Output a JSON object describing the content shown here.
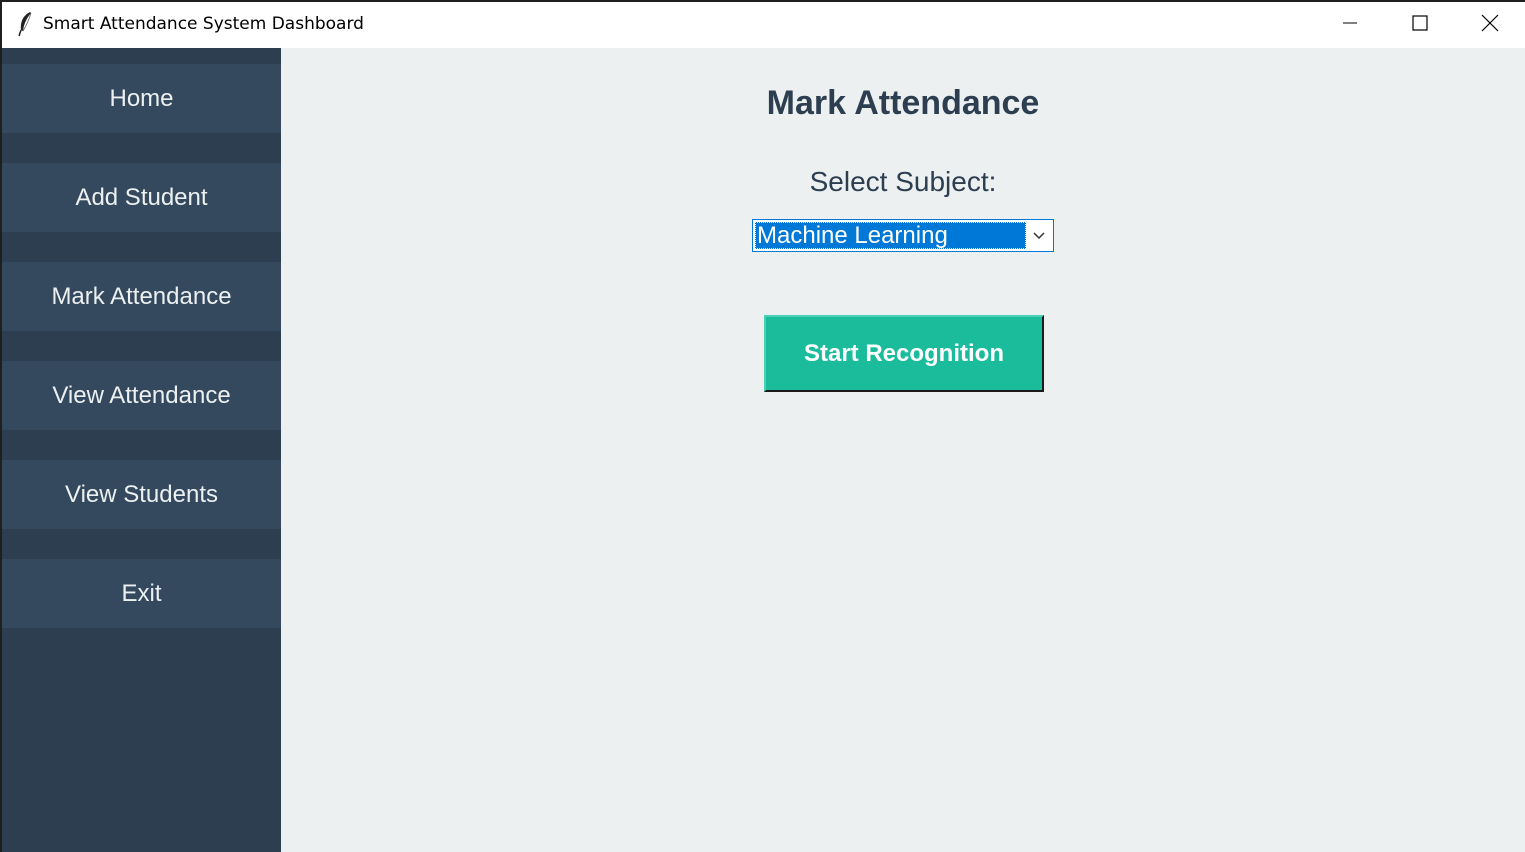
{
  "window": {
    "title": "Smart Attendance System Dashboard",
    "app_icon": "feather-icon",
    "controls": [
      "minimize-icon",
      "maximize-icon",
      "close-icon"
    ]
  },
  "sidebar": {
    "items": [
      {
        "label": "Home"
      },
      {
        "label": "Add Student"
      },
      {
        "label": "Mark Attendance"
      },
      {
        "label": "View Attendance"
      },
      {
        "label": "View Students"
      },
      {
        "label": "Exit"
      }
    ]
  },
  "main": {
    "title": "Mark Attendance",
    "subject_label": "Select Subject:",
    "subject_selected": "Machine Learning",
    "start_button": "Start Recognition"
  },
  "colors": {
    "sidebar_bg": "#2c3e50",
    "nav_item_bg": "#34495e",
    "nav_text": "#ecf0f1",
    "main_bg": "#ecf0f1",
    "heading_text": "#2c3e50",
    "accent_button": "#1abc9c",
    "selection": "#0078d7"
  }
}
